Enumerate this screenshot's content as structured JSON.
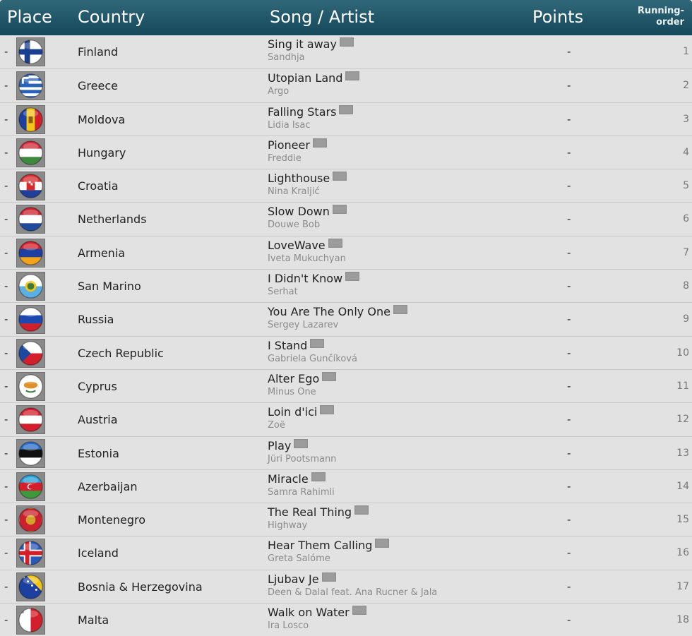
{
  "header": {
    "place": "Place",
    "country": "Country",
    "song": "Song / Artist",
    "points": "Points",
    "order_line1": "Running-",
    "order_line2": "order"
  },
  "rows": [
    {
      "place": "-",
      "country": "Finland",
      "song": "Sing it away",
      "artist": "Sandhja",
      "points": "-",
      "order": "1",
      "flag": "finland-flag-icon"
    },
    {
      "place": "-",
      "country": "Greece",
      "song": "Utopian Land",
      "artist": "Argo",
      "points": "-",
      "order": "2",
      "flag": "greece-flag-icon"
    },
    {
      "place": "-",
      "country": "Moldova",
      "song": "Falling Stars",
      "artist": "Lidia Isac",
      "points": "-",
      "order": "3",
      "flag": "moldova-flag-icon"
    },
    {
      "place": "-",
      "country": "Hungary",
      "song": "Pioneer",
      "artist": "Freddie",
      "points": "-",
      "order": "4",
      "flag": "hungary-flag-icon"
    },
    {
      "place": "-",
      "country": "Croatia",
      "song": "Lighthouse",
      "artist": "Nina Kraljić",
      "points": "-",
      "order": "5",
      "flag": "croatia-flag-icon"
    },
    {
      "place": "-",
      "country": "Netherlands",
      "song": "Slow Down",
      "artist": "Douwe Bob",
      "points": "-",
      "order": "6",
      "flag": "netherlands-flag-icon"
    },
    {
      "place": "-",
      "country": "Armenia",
      "song": "LoveWave",
      "artist": "Iveta Mukuchyan",
      "points": "-",
      "order": "7",
      "flag": "armenia-flag-icon"
    },
    {
      "place": "-",
      "country": "San Marino",
      "song": "I Didn't Know",
      "artist": "Serhat",
      "points": "-",
      "order": "8",
      "flag": "san-marino-flag-icon"
    },
    {
      "place": "-",
      "country": "Russia",
      "song": "You Are The Only One",
      "artist": "Sergey Lazarev",
      "points": "-",
      "order": "9",
      "flag": "russia-flag-icon"
    },
    {
      "place": "-",
      "country": "Czech Republic",
      "song": "I Stand",
      "artist": "Gabriela Gunčíková",
      "points": "-",
      "order": "10",
      "flag": "czech-flag-icon"
    },
    {
      "place": "-",
      "country": "Cyprus",
      "song": "Alter Ego",
      "artist": "Minus One",
      "points": "-",
      "order": "11",
      "flag": "cyprus-flag-icon"
    },
    {
      "place": "-",
      "country": "Austria",
      "song": "Loin d'ici",
      "artist": "Zoë",
      "points": "-",
      "order": "12",
      "flag": "austria-flag-icon"
    },
    {
      "place": "-",
      "country": "Estonia",
      "song": "Play",
      "artist": "Jüri Pootsmann",
      "points": "-",
      "order": "13",
      "flag": "estonia-flag-icon"
    },
    {
      "place": "-",
      "country": "Azerbaijan",
      "song": "Miracle",
      "artist": "Samra Rahimli",
      "points": "-",
      "order": "14",
      "flag": "azerbaijan-flag-icon"
    },
    {
      "place": "-",
      "country": "Montenegro",
      "song": "The Real Thing",
      "artist": "Highway",
      "points": "-",
      "order": "15",
      "flag": "montenegro-flag-icon"
    },
    {
      "place": "-",
      "country": "Iceland",
      "song": "Hear Them Calling",
      "artist": "Greta Salóme",
      "points": "-",
      "order": "16",
      "flag": "iceland-flag-icon"
    },
    {
      "place": "-",
      "country": "Bosnia & Herzegovina",
      "song": "Ljubav Je",
      "artist": "Deen & Dalal feat. Ana Rucner & Jala",
      "points": "-",
      "order": "17",
      "flag": "bosnia-flag-icon"
    },
    {
      "place": "-",
      "country": "Malta",
      "song": "Walk on Water",
      "artist": "Ira Losco",
      "points": "-",
      "order": "18",
      "flag": "malta-flag-icon"
    }
  ]
}
